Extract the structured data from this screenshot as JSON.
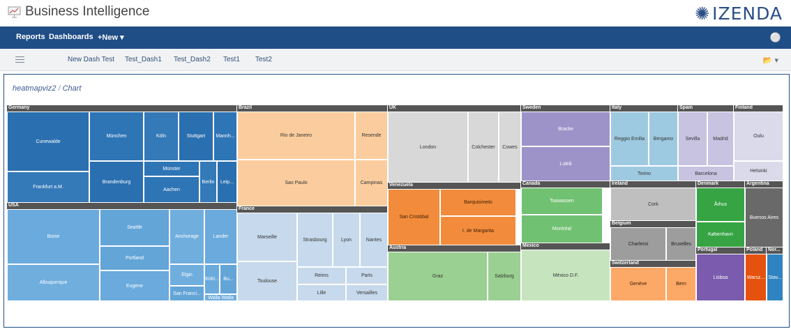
{
  "app": {
    "title": "Business Intelligence",
    "brand": "IZENDA",
    "app_icon": "presentation-icon",
    "brand_icon": "izenda-logo-icon"
  },
  "nav": {
    "reports": "Reports",
    "dashboards": "Dashboards",
    "new": "+New ▾",
    "user_icon": "user-icon"
  },
  "tabs": [
    "New Dash Test",
    "Test_Dash1",
    "Test_Dash2",
    "Test1",
    "Test2"
  ],
  "tabbar_icons": {
    "menu": "hamburger-icon",
    "folder": "folder-icon"
  },
  "breadcrumb": {
    "report": "heatmapviz2",
    "separator": "/",
    "part": "Chart"
  },
  "colors": {
    "germany": "#2e75b6",
    "usa": "#6aaadc",
    "brazil": "#fbcd9e",
    "france": "#c7d9ec",
    "uk": "#d8d8d8",
    "venezuela": "#f28c3c",
    "austria": "#9ad091",
    "sweden": "#9e93c9",
    "canada": "#71c172",
    "mexico": "#c6e5bf",
    "italy": "#9ecae1",
    "spain": "#c7c3e1",
    "finland": "#dadaeb",
    "ireland": "#bfbfbf",
    "belgium": "#9d9d9d",
    "switzerland": "#fca867",
    "denmark": "#36a443",
    "argentina": "#696969",
    "portugal": "#7a5bad",
    "poland": "#e4520d",
    "norway": "#2f83c0",
    "header": "#555555"
  },
  "chart_data": {
    "type": "heatmap",
    "title": "",
    "groups": [
      {
        "name": "Germany",
        "cells": [
          "Cunewalde",
          "München",
          "Köln",
          "Stuttgart",
          "Mannh...",
          "Frankfurt a.M.",
          "Brandenburg",
          "Münster",
          "Berlin",
          "Leip...",
          "Aachen"
        ]
      },
      {
        "name": "USA",
        "cells": [
          "Boise",
          "Seattle",
          "Anchorage",
          "Lander",
          "Portland",
          "Elgin",
          "Kirkl...",
          "Bu...",
          "Albuquerque",
          "Eugene",
          "San Franci...",
          "Walla Walla"
        ]
      },
      {
        "name": "Brazil",
        "cells": [
          "Rio de Janeiro",
          "Resende",
          "Sao Paulo",
          "Campinas"
        ]
      },
      {
        "name": "France",
        "cells": [
          "Marseille",
          "Strasbourg",
          "Lyon",
          "Nantes",
          "Toulouse",
          "Reims",
          "Paris",
          "Lille",
          "Versailles"
        ]
      },
      {
        "name": "UK",
        "cells": [
          "London",
          "Colchester",
          "Cowes"
        ]
      },
      {
        "name": "Venezuela",
        "cells": [
          "San Cristóbal",
          "Barquisimeto",
          "I. de Margarita"
        ]
      },
      {
        "name": "Austria",
        "cells": [
          "Graz",
          "Salzburg"
        ]
      },
      {
        "name": "Sweden",
        "cells": [
          "Bracke",
          "Luleå"
        ]
      },
      {
        "name": "Canada",
        "cells": [
          "Tsawassen",
          "Montréal"
        ]
      },
      {
        "name": "Mexico",
        "cells": [
          "México D.F."
        ]
      },
      {
        "name": "Italy",
        "cells": [
          "Reggio Emilia",
          "Bergamo",
          "Torino"
        ]
      },
      {
        "name": "Spain",
        "cells": [
          "Sevilla",
          "Madrid",
          "Barcelona"
        ]
      },
      {
        "name": "Finland",
        "cells": [
          "Oulu",
          "Helsinki"
        ]
      },
      {
        "name": "Ireland",
        "cells": [
          "Cork"
        ]
      },
      {
        "name": "Belgium",
        "cells": [
          "Charleroi",
          "Bruxelles"
        ]
      },
      {
        "name": "Switzerland",
        "cells": [
          "Genève",
          "Bern"
        ]
      },
      {
        "name": "Denmark",
        "cells": [
          "Århus",
          "København"
        ]
      },
      {
        "name": "Argentina",
        "cells": [
          "Buenos Aires"
        ]
      },
      {
        "name": "Portugal",
        "cells": [
          "Lisboa"
        ]
      },
      {
        "name": "Poland",
        "cells": [
          "Warsz..."
        ]
      },
      {
        "name": "Nor...",
        "cells": [
          "Stav..."
        ]
      }
    ]
  }
}
